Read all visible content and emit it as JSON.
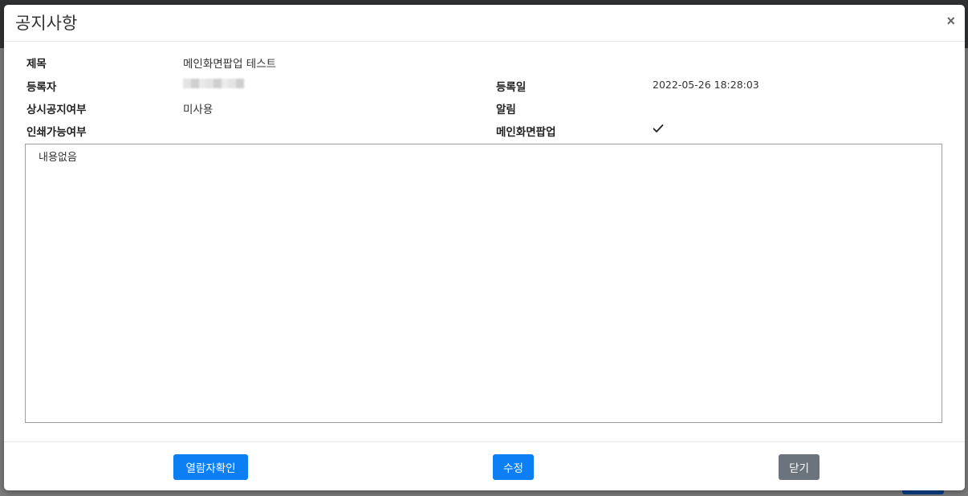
{
  "modal": {
    "title": "공지사항",
    "close_label": "×"
  },
  "info": {
    "title_label": "제목",
    "title_value": "메인화면팝업 테스트",
    "author_label": "등록자",
    "date_label": "등록일",
    "date_value": "2022-05-26 18:28:03",
    "pinned_label": "상시공지여부",
    "pinned_value": "미사용",
    "alert_label": "알림",
    "printable_label": "인쇄가능여부",
    "main_popup_label": "메인화면팝업"
  },
  "content": {
    "text": "내용없음"
  },
  "footer": {
    "viewers_button": "열람자확인",
    "edit_button": "수정",
    "close_button": "닫기"
  },
  "colors": {
    "primary": "#0d7ff5",
    "secondary": "#6b747c"
  }
}
